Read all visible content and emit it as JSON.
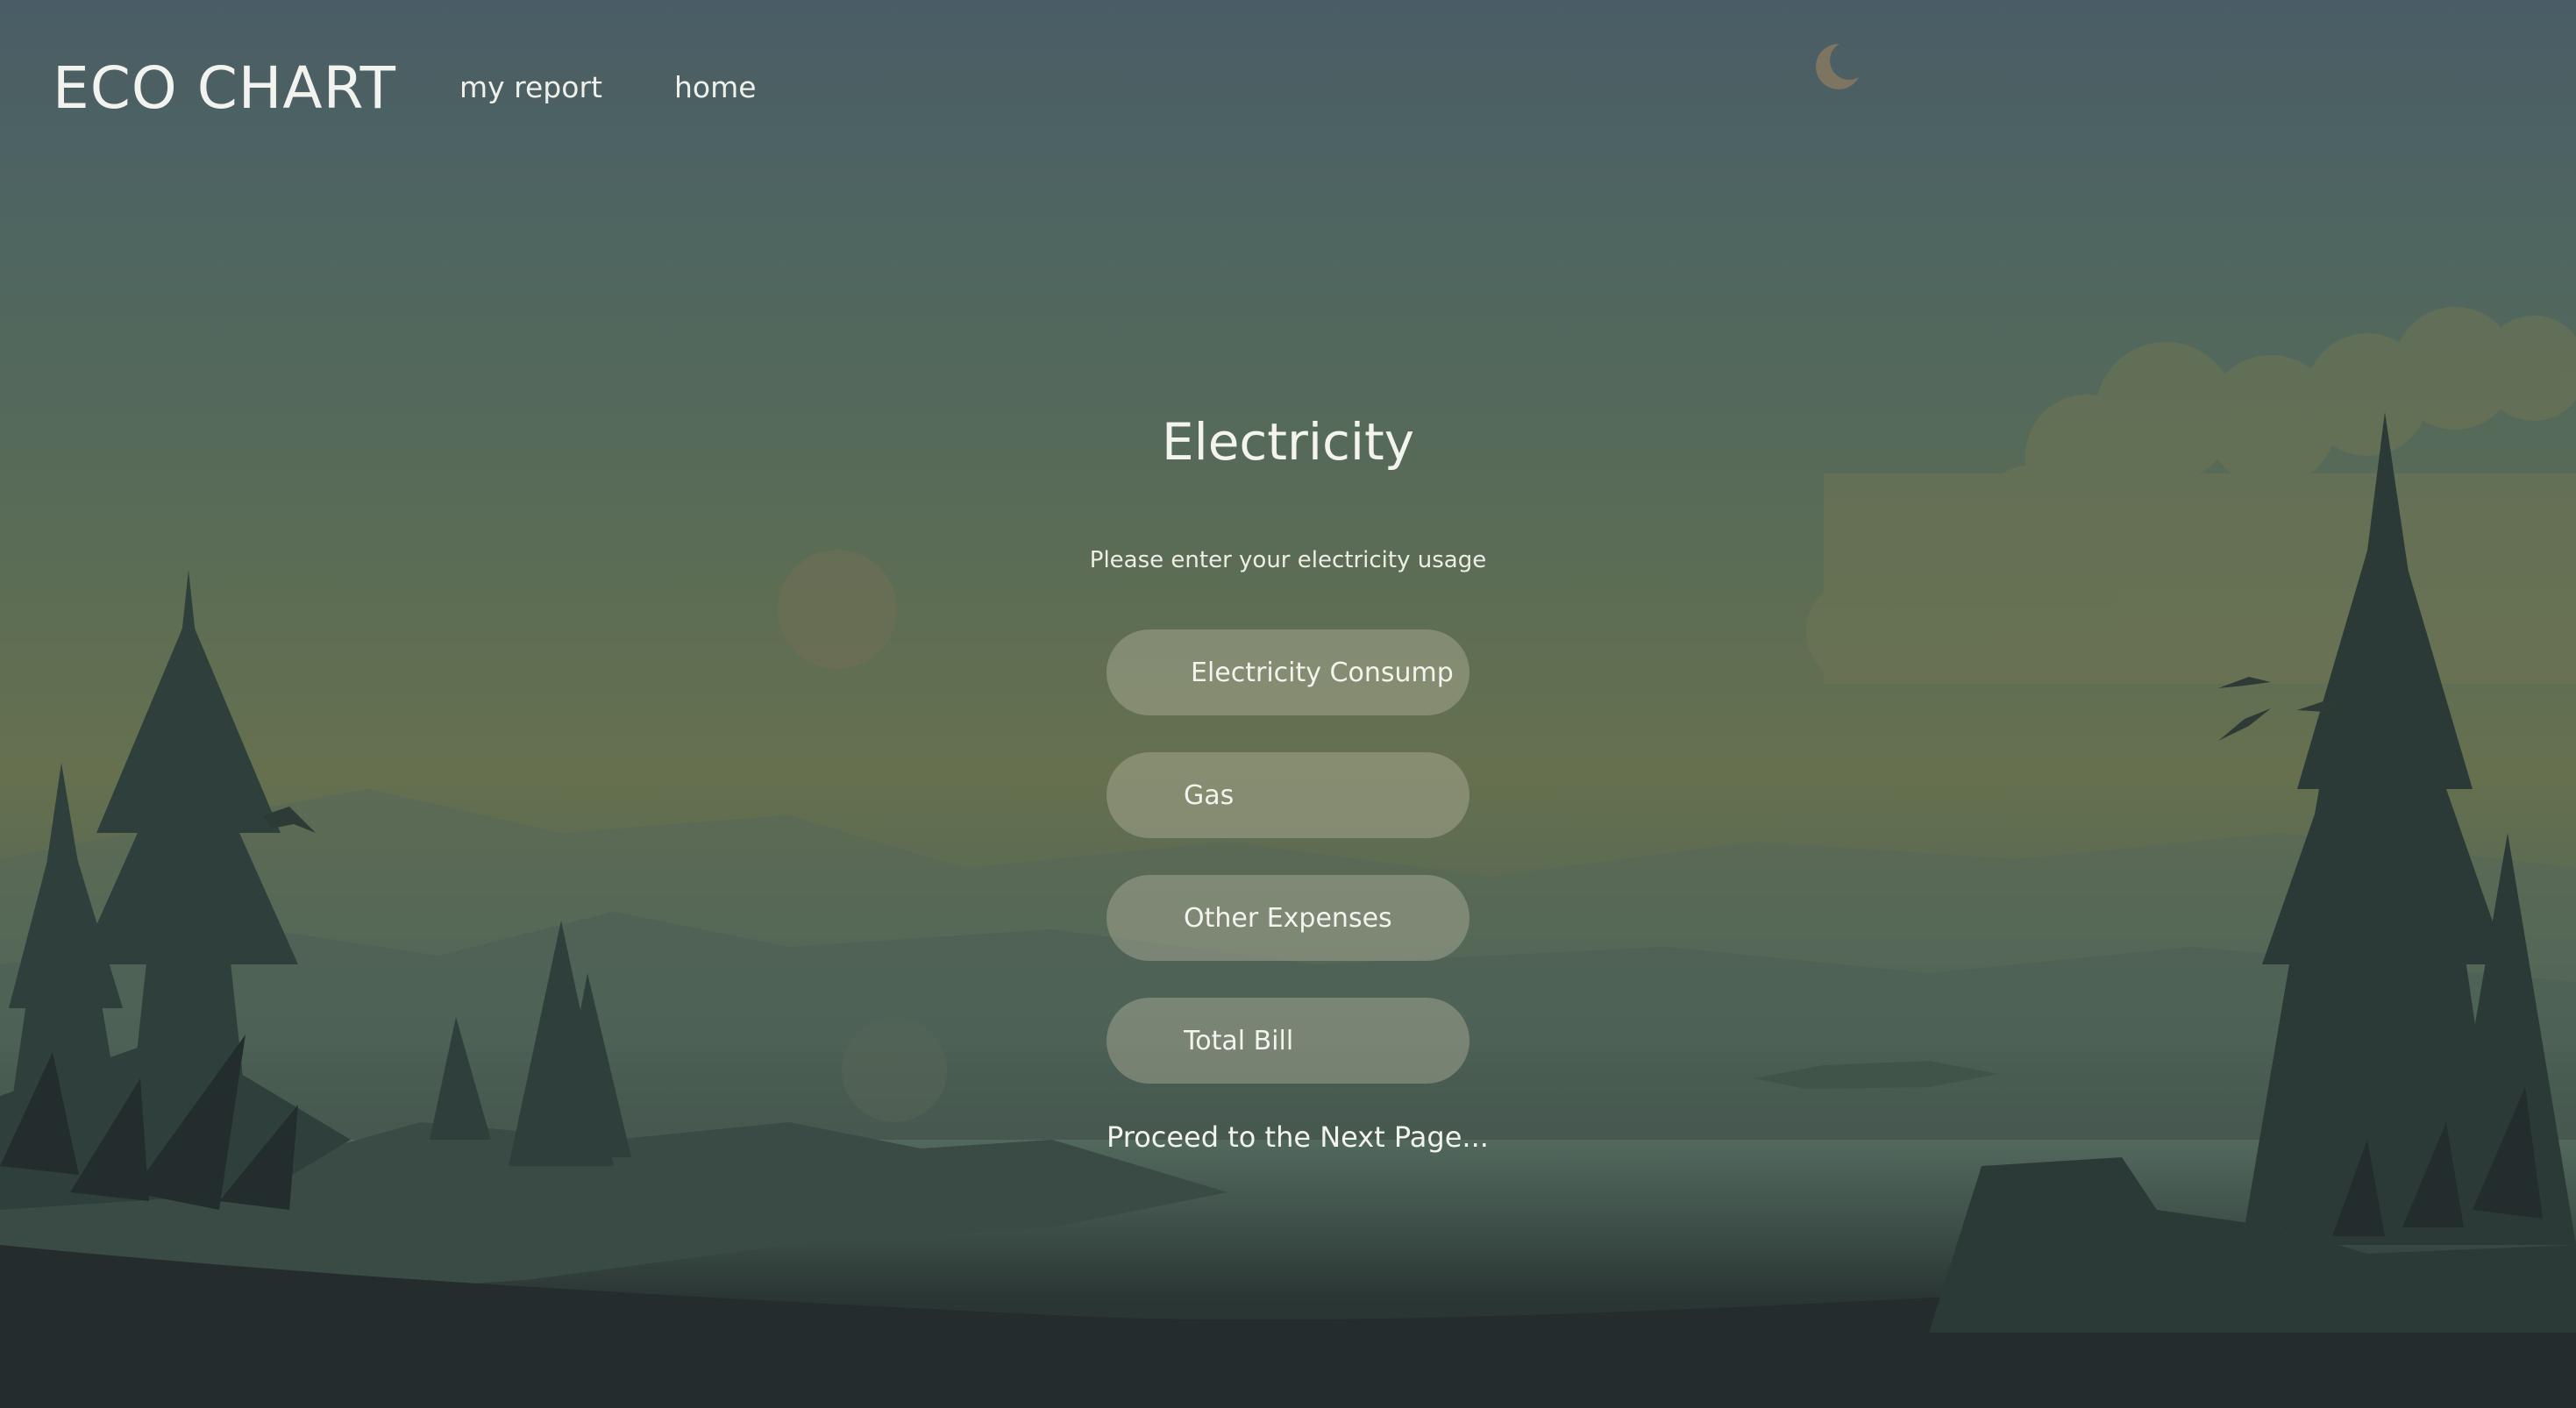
{
  "nav": {
    "logo": "ECO CHART",
    "links": [
      "my report",
      "home"
    ]
  },
  "form": {
    "title": "Electricity",
    "subtitle": "Please enter your electricity usage",
    "fields": [
      {
        "placeholder": "Electricity Consump"
      },
      {
        "placeholder": "Gas"
      },
      {
        "placeholder": "Other Expenses"
      },
      {
        "placeholder": "Total Bill"
      }
    ],
    "proceed": "Proceed to the Next Page..."
  },
  "background": {
    "scene": "misty-forest-lake-landscape",
    "colors": {
      "sky_top": "#4a5d66",
      "sky_mid": "#66704f",
      "ground": "#232b2c",
      "field_fill": "rgba(180,180,160,0.42)"
    }
  }
}
